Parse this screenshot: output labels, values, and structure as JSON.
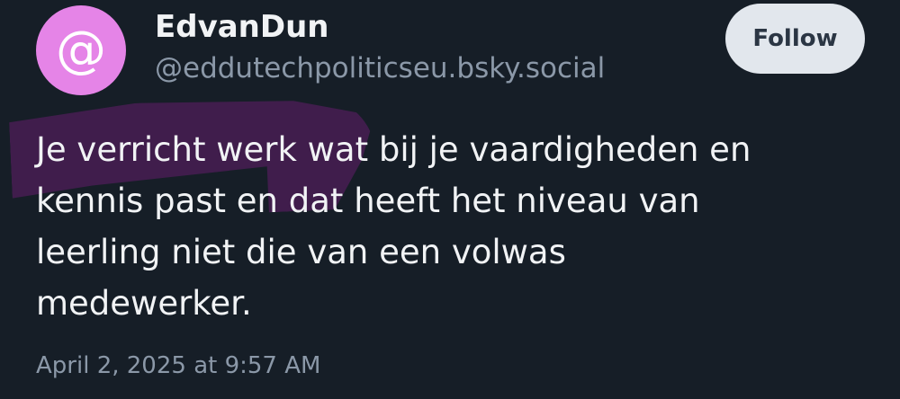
{
  "author": {
    "display_name": "EdvanDun",
    "handle": "@eddutechpoliticseu.bsky.social",
    "avatar_glyph": "@",
    "avatar_color": "#e584e7"
  },
  "actions": {
    "follow_label": "Follow"
  },
  "post": {
    "lines": [
      "Je verricht werk wat bij je vaardigheden en",
      "kennis past en dat heeft het niveau van",
      "leerling niet die van een volwas",
      "medewerker."
    ],
    "highlight_color": "#4d1d57"
  },
  "timestamp": "April 2, 2025 at 9:57 AM"
}
